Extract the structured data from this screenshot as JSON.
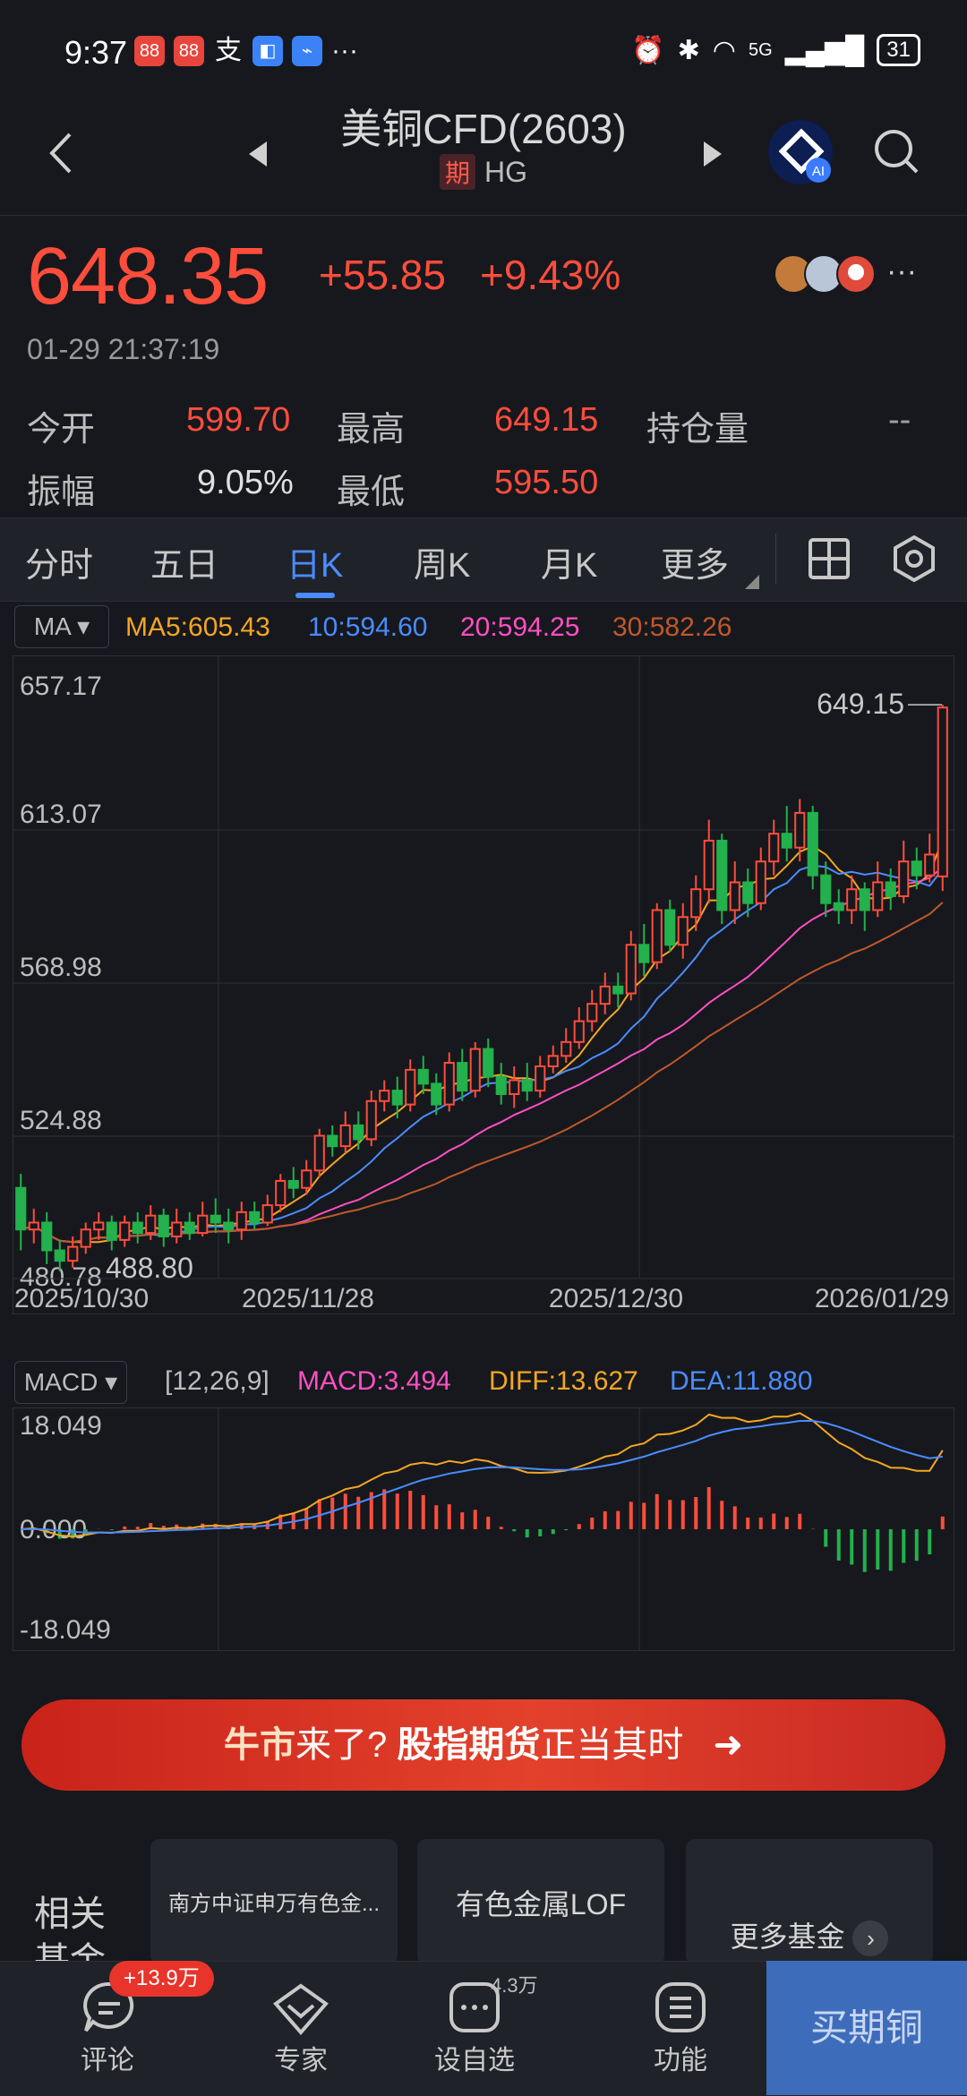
{
  "status": {
    "time": "9:37",
    "extra": "···",
    "network": "5G",
    "battery": "31"
  },
  "header": {
    "title": "美铜CFD(2603)",
    "badge": "期",
    "code": "HG"
  },
  "quote": {
    "price": "648.35",
    "change": "+55.85",
    "change_pct": "+9.43%",
    "timestamp": "01-29 21:37:19",
    "open_label": "今开",
    "open_value": "599.70",
    "high_label": "最高",
    "high_value": "649.15",
    "oi_label": "持仓量",
    "oi_value": "--",
    "amp_label": "振幅",
    "amp_value": "9.05%",
    "low_label": "最低",
    "low_value": "595.50"
  },
  "tabs": [
    "分时",
    "五日",
    "日K",
    "周K",
    "月K",
    "更多"
  ],
  "active_tab": "日K",
  "ma": {
    "selector": "MA",
    "ma5": "MA5:605.43",
    "ma10": "10:594.60",
    "ma20": "20:594.25",
    "ma30": "30:582.26"
  },
  "macd": {
    "selector": "MACD",
    "params": "[12,26,9]",
    "macd": "MACD:3.494",
    "diff": "DIFF:13.627",
    "dea": "DEA:11.880"
  },
  "colors": {
    "up": "#ff4d3c",
    "down": "#22b14c",
    "ma5": "#f5a623",
    "ma10": "#4a8cff",
    "ma20": "#ff4fc4",
    "ma30": "#c0582a"
  },
  "chart_data": [
    {
      "type": "candlestick",
      "y_ticks": [
        "657.17",
        "613.07",
        "568.98",
        "524.88",
        "480.78"
      ],
      "ylim": [
        480.78,
        657.17
      ],
      "x_ticks": [
        "2025/10/30",
        "2025/11/28",
        "2025/12/30",
        "2026/01/29"
      ],
      "annotations": {
        "high": "649.15",
        "low": "488.80"
      },
      "series": [
        {
          "name": "MA5"
        },
        {
          "name": "10"
        },
        {
          "name": "20"
        },
        {
          "name": "30"
        }
      ],
      "candles": [
        [
          510,
          498,
          514,
          492
        ],
        [
          498,
          500,
          504,
          494
        ],
        [
          500,
          492,
          503,
          488
        ],
        [
          492,
          489,
          495,
          486
        ],
        [
          489,
          493,
          496,
          487
        ],
        [
          493,
          498,
          500,
          491
        ],
        [
          498,
          500,
          503,
          495
        ],
        [
          500,
          495,
          502,
          492
        ],
        [
          495,
          500,
          502,
          493
        ],
        [
          500,
          497,
          503,
          494
        ],
        [
          497,
          502,
          505,
          495
        ],
        [
          502,
          496,
          504,
          493
        ],
        [
          496,
          500,
          504,
          494
        ],
        [
          500,
          497,
          503,
          495
        ],
        [
          497,
          502,
          506,
          496
        ],
        [
          502,
          500,
          507,
          497
        ],
        [
          500,
          498,
          504,
          494
        ],
        [
          498,
          503,
          506,
          495
        ],
        [
          503,
          500,
          506,
          498
        ],
        [
          500,
          505,
          508,
          499
        ],
        [
          505,
          512,
          514,
          503
        ],
        [
          512,
          510,
          516,
          507
        ],
        [
          510,
          515,
          518,
          508
        ],
        [
          515,
          525,
          527,
          513
        ],
        [
          525,
          522,
          528,
          519
        ],
        [
          522,
          528,
          532,
          520
        ],
        [
          528,
          524,
          532,
          521
        ],
        [
          524,
          535,
          538,
          522
        ],
        [
          535,
          538,
          541,
          532
        ],
        [
          538,
          534,
          542,
          530
        ],
        [
          534,
          544,
          547,
          532
        ],
        [
          544,
          540,
          548,
          537
        ],
        [
          540,
          534,
          543,
          531
        ],
        [
          534,
          546,
          549,
          532
        ],
        [
          546,
          538,
          550,
          535
        ],
        [
          538,
          550,
          552,
          536
        ],
        [
          550,
          542,
          553,
          539
        ],
        [
          542,
          537,
          546,
          534
        ],
        [
          537,
          541,
          545,
          533
        ],
        [
          541,
          538,
          546,
          535
        ],
        [
          538,
          545,
          548,
          536
        ],
        [
          545,
          548,
          551,
          543
        ],
        [
          548,
          552,
          556,
          546
        ],
        [
          552,
          558,
          562,
          550
        ],
        [
          558,
          563,
          567,
          555
        ],
        [
          563,
          568,
          572,
          560
        ],
        [
          568,
          566,
          572,
          562
        ],
        [
          566,
          580,
          584,
          564
        ],
        [
          580,
          575,
          586,
          571
        ],
        [
          575,
          590,
          592,
          573
        ],
        [
          590,
          580,
          593,
          578
        ],
        [
          580,
          588,
          592,
          576
        ],
        [
          588,
          596,
          600,
          584
        ],
        [
          596,
          610,
          616,
          592
        ],
        [
          610,
          590,
          612,
          586
        ],
        [
          590,
          598,
          604,
          586
        ],
        [
          598,
          592,
          602,
          588
        ],
        [
          592,
          604,
          608,
          590
        ],
        [
          604,
          612,
          616,
          600
        ],
        [
          612,
          608,
          620,
          604
        ],
        [
          608,
          618,
          622,
          604
        ],
        [
          618,
          600,
          620,
          596
        ],
        [
          600,
          592,
          604,
          588
        ],
        [
          592,
          590,
          596,
          586
        ],
        [
          590,
          596,
          600,
          586
        ],
        [
          596,
          590,
          598,
          584
        ],
        [
          590,
          598,
          604,
          588
        ],
        [
          598,
          594,
          602,
          590
        ],
        [
          594,
          604,
          610,
          592
        ],
        [
          604,
          600,
          608,
          596
        ],
        [
          600,
          606,
          612,
          598
        ],
        [
          599.7,
          648.35,
          649.15,
          595.5
        ]
      ]
    },
    {
      "type": "bar",
      "y_ticks": [
        "18.049",
        "0.000",
        "-18.049"
      ],
      "ylim": [
        -18.049,
        18.049
      ],
      "series": [
        {
          "name": "MACD"
        },
        {
          "name": "DIFF"
        },
        {
          "name": "DEA"
        }
      ]
    }
  ],
  "banner": {
    "part1": "牛市",
    "part2": "来了?",
    "part3": "股指期货",
    "part4": "正当其时"
  },
  "funds": {
    "label_line1": "相关",
    "label_line2": "基金",
    "card1_name": "南方中证申万有色金...",
    "card2_name": "有色金属LOF",
    "card3_name": "更多基金"
  },
  "bottom_nav": {
    "comment_badge": "+13.9万",
    "comment": "评论",
    "expert": "专家",
    "watch_count": "4.3万",
    "watch": "设自选",
    "func": "功能",
    "buy": "买期铜"
  }
}
